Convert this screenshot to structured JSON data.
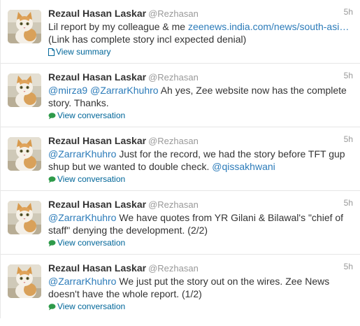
{
  "tweets": [
    {
      "fullname": "Rezaul Hasan Laskar",
      "handle": "@Rezhasan",
      "time": "5h",
      "pre": "Lil report by my colleague & me ",
      "link": "zeenews.india.com/news/south-asi…",
      "post": "(Link has complete story incl expected denial)",
      "action": "View summary",
      "action_icon": "document-icon"
    },
    {
      "fullname": "Rezaul Hasan Laskar",
      "handle": "@Rezhasan",
      "time": "5h",
      "mention1": "@mirza9",
      "mention2": "@ZarrarKhuhro",
      "body": " Ah yes, Zee website now has the complete story. Thanks.",
      "action": "View conversation",
      "action_icon": "speech-bubble-icon"
    },
    {
      "fullname": "Rezaul Hasan Laskar",
      "handle": "@Rezhasan",
      "time": "5h",
      "mention1": "@ZarrarKhuhro",
      "body": " Just for the record, we had the story before TFT gup shup but we wanted to double check. ",
      "mention2": "@qissakhwani",
      "action": "View conversation",
      "action_icon": "speech-bubble-icon"
    },
    {
      "fullname": "Rezaul Hasan Laskar",
      "handle": "@Rezhasan",
      "time": "5h",
      "mention1": "@ZarrarKhuhro",
      "body": " We have quotes from YR Gilani & Bilawal's \"chief of staff\" denying the development. (2/2)",
      "action": "View conversation",
      "action_icon": "speech-bubble-icon"
    },
    {
      "fullname": "Rezaul Hasan Laskar",
      "handle": "@Rezhasan",
      "time": "5h",
      "mention1": "@ZarrarKhuhro",
      "body": " We just put the story out on the wires. Zee News doesn't have the whole report. (1/2)",
      "action": "View conversation",
      "action_icon": "speech-bubble-icon"
    }
  ]
}
